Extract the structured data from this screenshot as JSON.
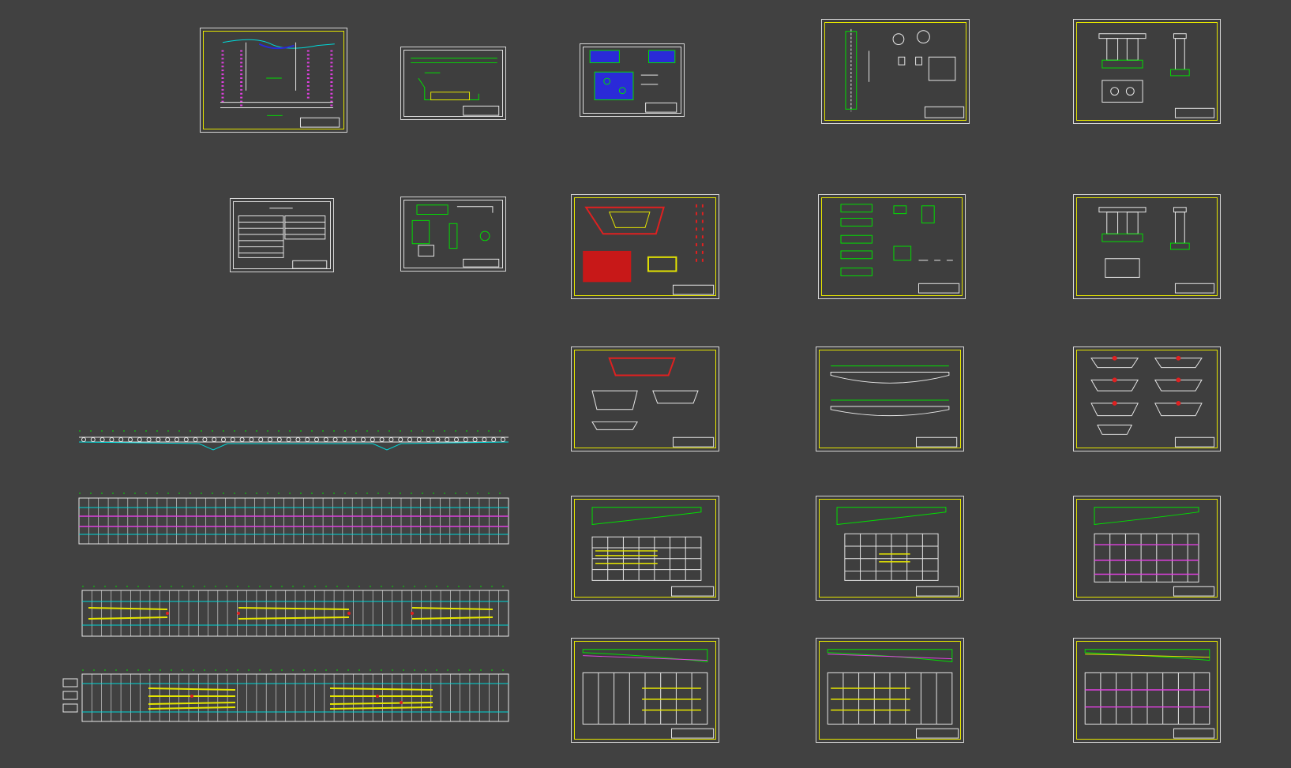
{
  "viewport": {
    "background": "#414141"
  },
  "colors": {
    "frame": "#d8d8d8",
    "yellow": "#e6e600",
    "green": "#00e000",
    "cyan": "#00d8d8",
    "magenta": "#e040e0",
    "red": "#e02020",
    "blue": "#2a2ad8",
    "white": "#e8e8e8"
  },
  "drawing_sheets": [
    {
      "id": "sheet-general-elevation",
      "kind": "elevation"
    },
    {
      "id": "sheet-bridge-layout",
      "kind": "layout"
    },
    {
      "id": "sheet-bearing-plan",
      "kind": "bearing"
    },
    {
      "id": "sheet-pier-rebar",
      "kind": "pier"
    },
    {
      "id": "sheet-pier-a",
      "kind": "pierframe"
    },
    {
      "id": "sheet-quantity-table",
      "kind": "table"
    },
    {
      "id": "sheet-abutment-detail",
      "kind": "abutment"
    },
    {
      "id": "sheet-box-section-rebar",
      "kind": "boxrebar"
    },
    {
      "id": "sheet-segment-details",
      "kind": "segments"
    },
    {
      "id": "sheet-pier-b",
      "kind": "pierframe"
    },
    {
      "id": "sheet-box-girder-sections",
      "kind": "boxsections"
    },
    {
      "id": "sheet-girder-elevation",
      "kind": "girderelev"
    },
    {
      "id": "sheet-typical-sections",
      "kind": "typicalsections"
    },
    {
      "id": "sheet-prestress-layout-1",
      "kind": "prestress"
    },
    {
      "id": "sheet-prestress-layout-2",
      "kind": "prestress"
    },
    {
      "id": "sheet-prestress-layout-3",
      "kind": "prestress"
    },
    {
      "id": "sheet-tendon-layout-1",
      "kind": "tendon"
    },
    {
      "id": "sheet-tendon-layout-2",
      "kind": "tendon"
    },
    {
      "id": "sheet-tendon-layout-3",
      "kind": "tendon"
    }
  ],
  "strips": [
    {
      "id": "strip-longitudinal-profile",
      "kind": "profile"
    },
    {
      "id": "strip-plan-1",
      "kind": "plan"
    },
    {
      "id": "strip-plan-2",
      "kind": "plan"
    },
    {
      "id": "strip-plan-3",
      "kind": "plan"
    }
  ]
}
